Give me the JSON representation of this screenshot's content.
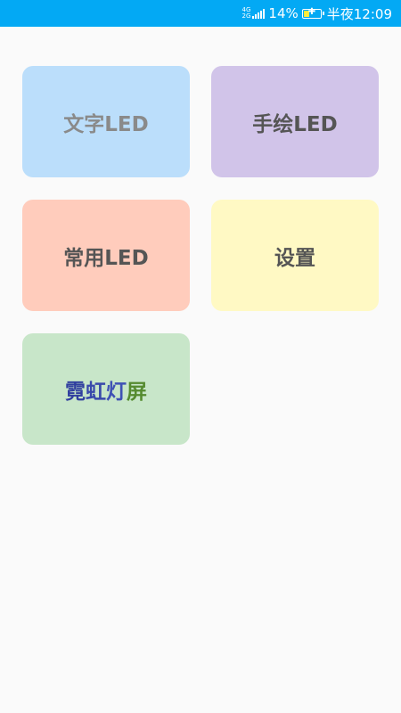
{
  "status_bar": {
    "network_top": "4G",
    "network_bottom": "2G",
    "battery_text": "14%",
    "time_text": "半夜12:09",
    "background_color": "#03a9f4"
  },
  "tiles": {
    "text_led": {
      "label": "文字LED",
      "background_color": "#bbdefb"
    },
    "hand_drawn_led": {
      "label": "手绘LED",
      "background_color": "#d1c4e9"
    },
    "common_led": {
      "label": "常用LED",
      "background_color": "#ffccbc"
    },
    "settings": {
      "label": "设置",
      "background_color": "#fff9c4"
    },
    "neon_screen": {
      "chars": [
        "霓",
        "虹",
        "灯",
        "屏"
      ],
      "char_colors": [
        "#303f9f",
        "#3949ab",
        "#3f51b5",
        "#558b2f"
      ],
      "background_color": "#c8e6c9"
    }
  }
}
